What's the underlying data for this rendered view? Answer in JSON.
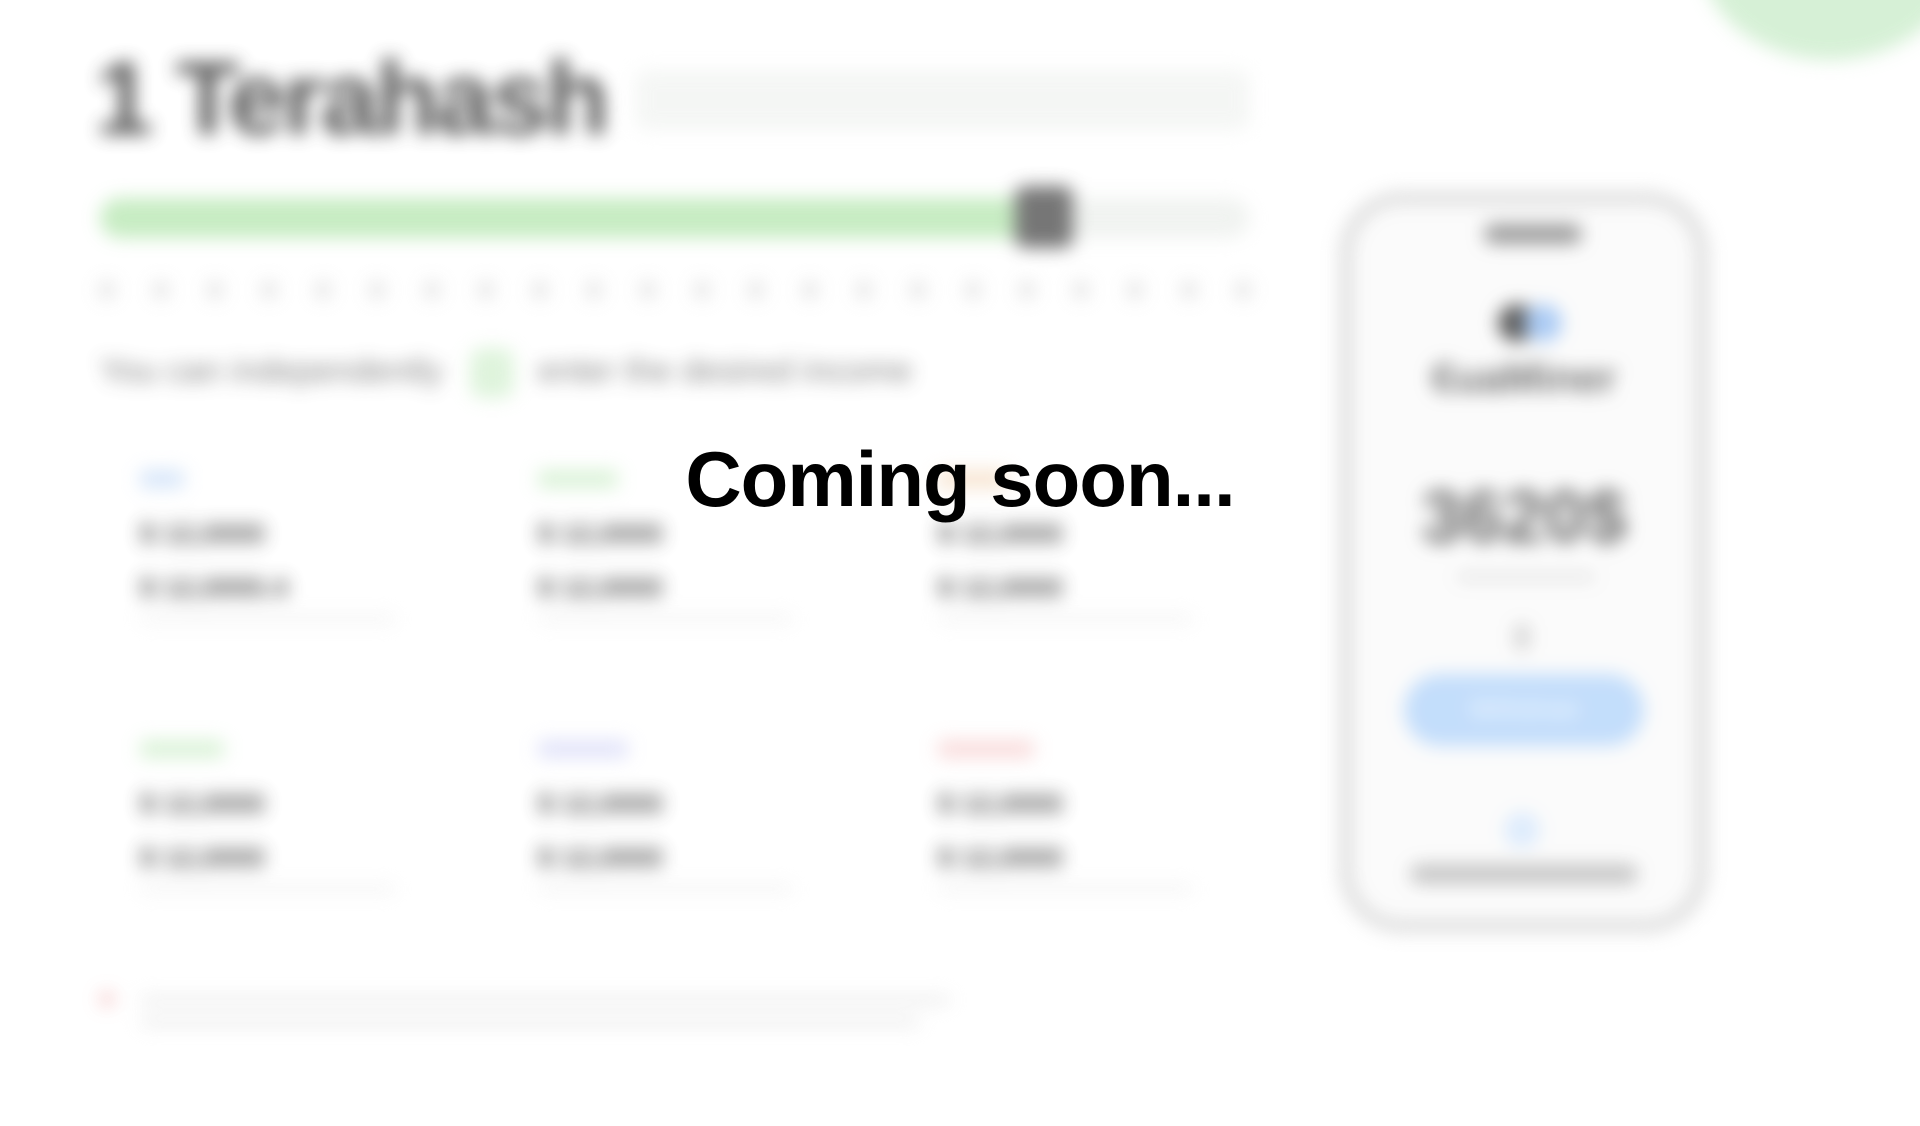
{
  "overlay": {
    "message": "Coming soon..."
  },
  "background": {
    "title": "1 Terahash",
    "slider_progress_percent": 83,
    "hint_before": "You can independently",
    "hint_after": "enter the desired income",
    "stats": [
      {
        "color": "#9fc5f2",
        "values": [
          "$ 12,0000",
          "$ 12,0000.4"
        ]
      },
      {
        "color": "#a6dca2",
        "values": [
          "$ 12,0000",
          "$ 12,0000"
        ]
      },
      {
        "color": "#f3c9a0",
        "values": [
          "$ 12,0000",
          "$ 12,0000"
        ]
      },
      {
        "color": "#a6dca2",
        "values": [
          "$ 12,0000",
          "$ 12,0000"
        ]
      },
      {
        "color": "#b4b7f2",
        "values": [
          "$ 12,0000",
          "$ 12,0000"
        ]
      },
      {
        "color": "#f3a8a8",
        "values": [
          "$ 12,0000",
          "$ 12,0000"
        ]
      }
    ],
    "phone": {
      "brand": "€uaMiner",
      "amount": "3620$",
      "button": "Withdraw"
    },
    "colors": {
      "accent_green": "#bde9b8",
      "accent_blue": "#b9d8fb"
    }
  }
}
